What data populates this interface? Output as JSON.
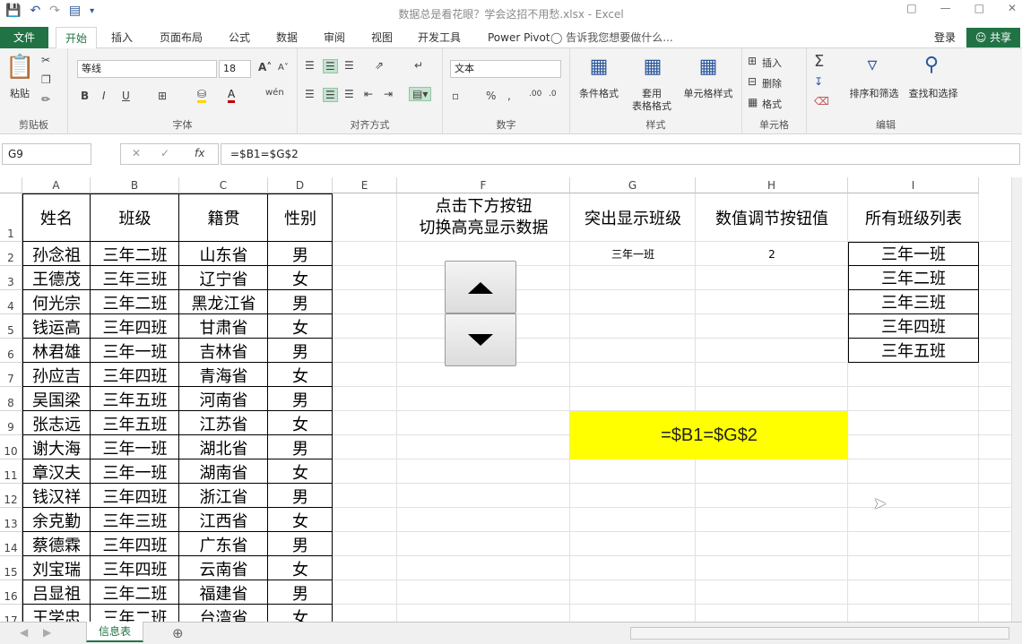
{
  "window": {
    "title": "数据总是看花眼？学会这招不用愁.xlsx - Excel"
  },
  "tabs": {
    "file": "文件",
    "home": "开始",
    "insert": "插入",
    "layout": "页面布局",
    "formulas": "公式",
    "data": "数据",
    "review": "审阅",
    "view": "视图",
    "developer": "开发工具",
    "powerpivot": "Power Pivot",
    "tellme": "告诉我您想要做什么...",
    "login": "登录",
    "share": "共享"
  },
  "ribbon": {
    "paste": "粘贴",
    "clipboard": "剪贴板",
    "font_name": "等线",
    "font_size": "18",
    "font_group": "字体",
    "align_group": "对齐方式",
    "number_format": "文本",
    "number_group": "数字",
    "cond_format": "条件格式",
    "table_format_1": "套用",
    "table_format_2": "表格格式",
    "cell_style": "单元格样式",
    "styles_group": "样式",
    "insert": "插入",
    "delete": "删除",
    "format": "格式",
    "cells_group": "单元格",
    "sort_filter": "排序和筛选",
    "find_select": "查找和选择",
    "edit_group": "编辑"
  },
  "formula_bar": {
    "name_box": "G9",
    "formula": "=$B1=$G$2"
  },
  "columns": [
    "A",
    "B",
    "C",
    "D",
    "E",
    "F",
    "G",
    "H",
    "I"
  ],
  "rows": [
    "1",
    "2",
    "3",
    "4",
    "5",
    "6",
    "7",
    "8",
    "9",
    "10",
    "11",
    "12",
    "13",
    "14",
    "15",
    "16",
    "17"
  ],
  "table_headers": [
    "姓名",
    "班级",
    "籍贯",
    "性别"
  ],
  "table_rows": [
    [
      "孙念祖",
      "三年二班",
      "山东省",
      "男"
    ],
    [
      "王德茂",
      "三年三班",
      "辽宁省",
      "女"
    ],
    [
      "何光宗",
      "三年二班",
      "黑龙江省",
      "男"
    ],
    [
      "钱运高",
      "三年四班",
      "甘肃省",
      "女"
    ],
    [
      "林君雄",
      "三年一班",
      "吉林省",
      "男"
    ],
    [
      "孙应吉",
      "三年四班",
      "青海省",
      "女"
    ],
    [
      "吴国梁",
      "三年五班",
      "河南省",
      "男"
    ],
    [
      "张志远",
      "三年五班",
      "江苏省",
      "女"
    ],
    [
      "谢大海",
      "三年一班",
      "湖北省",
      "男"
    ],
    [
      "章汉夫",
      "三年一班",
      "湖南省",
      "女"
    ],
    [
      "钱汉祥",
      "三年四班",
      "浙江省",
      "男"
    ],
    [
      "余克勤",
      "三年三班",
      "江西省",
      "女"
    ],
    [
      "蔡德霖",
      "三年四班",
      "广东省",
      "男"
    ],
    [
      "刘宝瑞",
      "三年四班",
      "云南省",
      "女"
    ],
    [
      "吕显祖",
      "三年二班",
      "福建省",
      "男"
    ],
    [
      "王学忠",
      "三年二班",
      "台湾省",
      "女"
    ]
  ],
  "F1": {
    "line1": "点击下方按钮",
    "line2": "切换高亮显示数据"
  },
  "G1": "突出显示班级",
  "H1": "数值调节按钮值",
  "I1": "所有班级列表",
  "G2": "三年一班",
  "H2": "2",
  "class_list": [
    "三年一班",
    "三年二班",
    "三年三班",
    "三年四班",
    "三年五班"
  ],
  "highlight_text": "=$B1=$G$2",
  "sheet_tab": "信息表"
}
